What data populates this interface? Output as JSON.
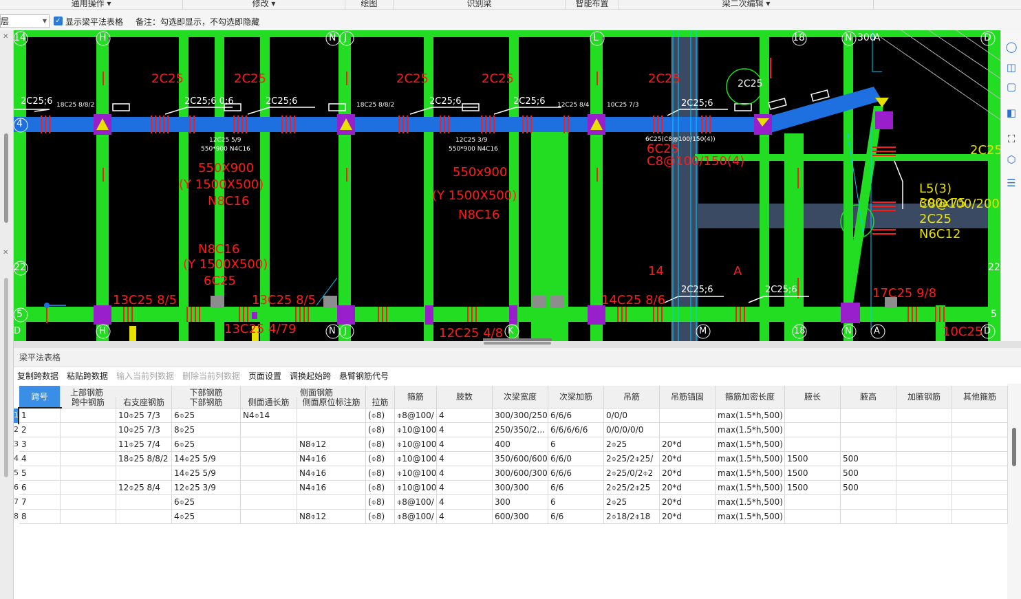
{
  "ribbon": {
    "groups": [
      "通用操作",
      "修改",
      "绘图",
      "识别梁",
      "智能布置",
      "梁二次编辑"
    ]
  },
  "options": {
    "floor_value": "首层",
    "show_table_label": "显示梁平法表格",
    "note": "备注：勾选即显示，不勾选即隐藏"
  },
  "cad": {
    "axis_labels_top": [
      "14",
      "H",
      "N",
      "J",
      "L",
      "18",
      "N",
      "300",
      "A",
      "D"
    ],
    "axis_labels_bottom": [
      "D",
      "H",
      "N",
      "J",
      "K",
      "M",
      "18",
      "N",
      "A",
      "D"
    ],
    "axis_labels_left": [
      "4",
      "22",
      "5"
    ],
    "axis_labels_right": [
      "22",
      "5"
    ],
    "beam_texts": [
      "2C25;6",
      "2C25;6 0;6",
      "2C25;6",
      "2C25;6",
      "2C25;6",
      "2C25;6",
      "2C25;6",
      "2C25;6",
      "18C25 8/8/2",
      "18C25 8/8/2",
      "12C25 8/4",
      "10C25 7/3",
      "6C25(C8@100/150(4))",
      "550*900 N4C16",
      "550*900 N4C16",
      "12C25 5/9",
      "12C25 3/9",
      "550X900",
      "(Y 1500X500)",
      "N8C16",
      "550x900",
      "(Y 1500X500)",
      "N8C16",
      "N8C16",
      "(Y 1500X500)",
      "6C25",
      "6C25",
      "C8@100/150(4)",
      "13C25 8/5",
      "13C25 8/5",
      "14C25 8/6",
      "12C25 4/8",
      "13C25 4/79",
      "17C25 9/8",
      "10C25",
      "L5(3) 300x75",
      "C8@100/200(2)",
      "2C25",
      "N6C12",
      "2C25",
      "2C25",
      "2C25",
      "2C25",
      "2C25",
      "2C25",
      "14",
      "A",
      "2C25"
    ],
    "colors": {
      "beam_blue": "#1e6fe0",
      "column_green": "#22dd22",
      "rebar_red": "#ff1a1a",
      "purple": "#9a1fcc",
      "yellow": "#e8e000",
      "white": "#ffffff",
      "slab_gray": "#3b4a63"
    }
  },
  "right_tools": [
    "orbit-icon",
    "3d-icon",
    "cube-icon",
    "solid-icon",
    "fullscreen-icon",
    "layer-icon",
    "properties-icon"
  ],
  "panel": {
    "title": "梁平法表格",
    "toolbar": [
      {
        "label": "复制跨数据",
        "enabled": true
      },
      {
        "label": "粘贴跨数据",
        "enabled": true
      },
      {
        "label": "输入当前列数据",
        "enabled": false
      },
      {
        "label": "删除当前列数据",
        "enabled": false
      },
      {
        "label": "页面设置",
        "enabled": true
      },
      {
        "label": "调换起始跨",
        "enabled": true
      },
      {
        "label": "悬臂钢筋代号",
        "enabled": true
      }
    ],
    "group_headers": [
      "上部钢筋",
      "下部钢筋",
      "侧面钢筋"
    ],
    "columns": [
      "跨号",
      "跨中钢筋",
      "右支座钢筋",
      "下部钢筋",
      "侧面通长筋",
      "侧面原位标注筋",
      "拉筋",
      "箍筋",
      "肢数",
      "次梁宽度",
      "次梁加筋",
      "吊筋",
      "吊筋锚固",
      "箍筋加密长度",
      "腋长",
      "腋高",
      "加腋钢筋",
      "其他箍筋"
    ],
    "rows": [
      [
        "1",
        "",
        "10⌽25 7/3",
        "6⌽25",
        "N4⌽14",
        "",
        "(⌽8)",
        "⌽8@100/",
        "4",
        "300/300/250",
        "6/6/6",
        "0/0/0",
        "",
        "max(1.5*h,500)",
        "",
        "",
        "",
        ""
      ],
      [
        "2",
        "",
        "10⌽25 7/3",
        "8⌽25",
        "",
        "",
        "(⌽8)",
        "⌽10@100",
        "4",
        "250/350/2...",
        "6/6/6/6/6",
        "0/0/0/0/0",
        "",
        "max(1.5*h,500)",
        "",
        "",
        "",
        ""
      ],
      [
        "3",
        "",
        "11⌽25 7/4",
        "6⌽25",
        "",
        "N8⌽12",
        "(⌽8)",
        "⌽10@100",
        "4",
        "400",
        "6",
        "2⌽25",
        "20*d",
        "max(1.5*h,500)",
        "",
        "",
        "",
        ""
      ],
      [
        "4",
        "",
        "18⌽25 8/8/2",
        "14⌽25 5/9",
        "",
        "N4⌽16",
        "(⌽8)",
        "⌽10@100",
        "4",
        "350/600/600",
        "6/6/0",
        "2⌽25/2⌽25/",
        "20*d",
        "max(1.5*h,500)",
        "1500",
        "500",
        "",
        ""
      ],
      [
        "5",
        "",
        "",
        "14⌽25 5/9",
        "",
        "N4⌽16",
        "(⌽8)",
        "⌽10@100",
        "4",
        "300/600/300",
        "6/6/6",
        "2⌽25/0/2⌽2",
        "20*d",
        "max(1.5*h,500)",
        "1500",
        "500",
        "",
        ""
      ],
      [
        "6",
        "",
        "12⌽25 8/4",
        "12⌽25 3/9",
        "",
        "N4⌽16",
        "(⌽8)",
        "⌽10@100",
        "4",
        "300/300",
        "6/6",
        "2⌽25/2⌽25",
        "20*d",
        "max(1.5*h,500)",
        "1500",
        "500",
        "",
        ""
      ],
      [
        "7",
        "",
        "",
        "6⌽25",
        "",
        "",
        "(⌽8)",
        "⌽8@100/",
        "4",
        "300",
        "6",
        "2⌽25",
        "20*d",
        "max(1.5*h,500)",
        "",
        "",
        "",
        ""
      ],
      [
        "8",
        "",
        "",
        "4⌽25",
        "",
        "N8⌽12",
        "(⌽8)",
        "⌽8@100/",
        "4",
        "600/300",
        "6/6",
        "2⌽18/2⌽18",
        "20*d",
        "max(1.5*h,500)",
        "",
        "",
        "",
        ""
      ]
    ],
    "row_numbers": [
      "1",
      "2",
      "3",
      "4",
      "5",
      "6",
      "7",
      "8"
    ]
  }
}
